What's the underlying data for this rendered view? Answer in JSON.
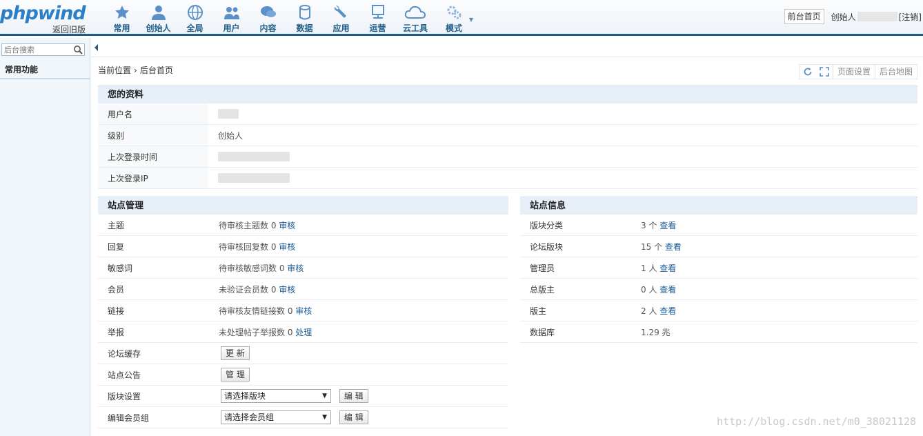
{
  "logo": {
    "brand": "phpwind",
    "sub": "返回旧版"
  },
  "nav": [
    {
      "label": "常用",
      "icon": "star-icon"
    },
    {
      "label": "创始人",
      "icon": "user-icon"
    },
    {
      "label": "全局",
      "icon": "globe-icon"
    },
    {
      "label": "用户",
      "icon": "users-icon"
    },
    {
      "label": "内容",
      "icon": "chat-icon"
    },
    {
      "label": "数据",
      "icon": "database-icon"
    },
    {
      "label": "应用",
      "icon": "wrench-icon"
    },
    {
      "label": "运营",
      "icon": "monitor-icon"
    },
    {
      "label": "云工具",
      "icon": "cloud-icon"
    },
    {
      "label": "模式",
      "icon": "gear-icon"
    }
  ],
  "header": {
    "front_button": "前台首页",
    "user_prefix": "创始人",
    "logout": "[注销]"
  },
  "sidebar": {
    "search_placeholder": "后台搜索",
    "title": "常用功能"
  },
  "breadcrumb": {
    "prefix": "当前位置",
    "separator": "›",
    "current": "后台首页"
  },
  "tools": {
    "page_settings": "页面设置",
    "site_map": "后台地图"
  },
  "profile": {
    "title": "您的资料",
    "rows": [
      {
        "key": "用户名",
        "value": ""
      },
      {
        "key": "级别",
        "value": "创始人"
      },
      {
        "key": "上次登录时间",
        "value": ""
      },
      {
        "key": "上次登录IP",
        "value": ""
      }
    ]
  },
  "site_manage": {
    "title": "站点管理",
    "rows": [
      {
        "key": "主题",
        "value": "待审核主题数 0",
        "link": "审核"
      },
      {
        "key": "回复",
        "value": "待审核回复数 0",
        "link": "审核"
      },
      {
        "key": "敏感词",
        "value": "待审核敏感词数 0",
        "link": "审核"
      },
      {
        "key": "会员",
        "value": "未验证会员数 0",
        "link": "审核"
      },
      {
        "key": "链接",
        "value": "待审核友情链接数 0",
        "link": "审核"
      },
      {
        "key": "举报",
        "value": "未处理帖子举报数 0",
        "link": "处理"
      }
    ],
    "cache": {
      "key": "论坛缓存",
      "button": "更 新"
    },
    "notice": {
      "key": "站点公告",
      "button": "管 理"
    },
    "forum_setting": {
      "key": "版块设置",
      "select": "请选择版块",
      "button": "编 辑"
    },
    "group_edit": {
      "key": "编辑会员组",
      "select": "请选择会员组",
      "button": "编 辑"
    }
  },
  "site_info": {
    "title": "站点信息",
    "rows": [
      {
        "key": "版块分类",
        "value": "3 个",
        "link": "查看"
      },
      {
        "key": "论坛版块",
        "value": "15 个",
        "link": "查看"
      },
      {
        "key": "管理员",
        "value": "1 人",
        "link": "查看"
      },
      {
        "key": "总版主",
        "value": "0 人",
        "link": "查看"
      },
      {
        "key": "版主",
        "value": "2 人",
        "link": "查看"
      },
      {
        "key": "数据库",
        "value": "1.29 兆",
        "link": ""
      }
    ]
  },
  "watermark": "http://blog.csdn.net/m0_38021128",
  "colors": {
    "accent": "#1f5d88",
    "link": "#1a5a96",
    "panel_head": "#e7eff8"
  }
}
